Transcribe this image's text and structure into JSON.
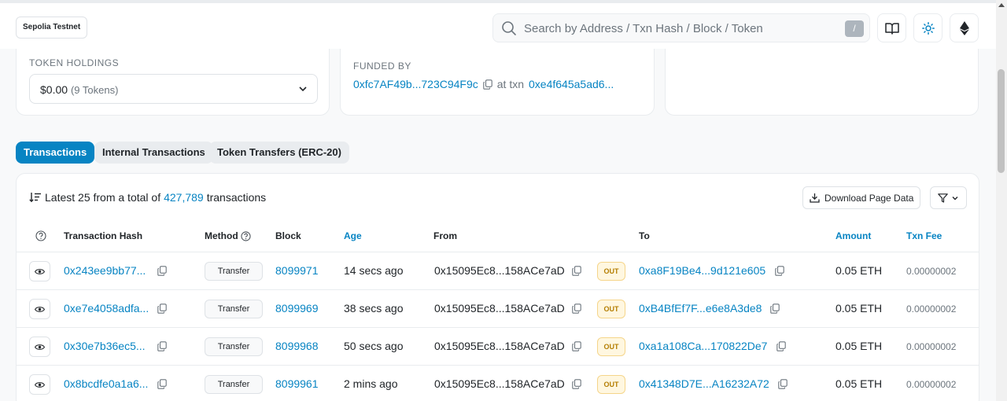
{
  "header": {
    "network_badge": "Sepolia Testnet",
    "search_placeholder": "Search by Address / Txn Hash / Block / Token",
    "search_shortcut": "/"
  },
  "overview": {
    "token_holdings_label": "TOKEN HOLDINGS",
    "token_holdings_value": "$0.00",
    "token_holdings_count": "(9 Tokens)",
    "funded_by_label": "FUNDED BY",
    "funded_by_address": "0xfc7AF49b...723C94F9c",
    "at_txn_text": "at txn",
    "funded_by_txn": "0xe4f645a5ad6..."
  },
  "tabs": [
    {
      "label": "Transactions",
      "active": true
    },
    {
      "label": "Internal Transactions",
      "active": false
    },
    {
      "label": "Token Transfers (ERC-20)",
      "active": false
    }
  ],
  "table": {
    "summary_prefix": "Latest 25 from a total of",
    "summary_count": "427,789",
    "summary_suffix": "transactions",
    "download_label": "Download Page Data",
    "columns": {
      "hash": "Transaction Hash",
      "method": "Method",
      "block": "Block",
      "age": "Age",
      "from": "From",
      "to": "To",
      "amount": "Amount",
      "fee": "Txn Fee"
    },
    "rows": [
      {
        "hash": "0x243ee9bb77...",
        "method": "Transfer",
        "block": "8099971",
        "age": "14 secs ago",
        "from": "0x15095Ec8...158ACe7aD",
        "direction": "OUT",
        "to": "0xa8F19Be4...9d121e605",
        "amount": "0.05 ETH",
        "fee": "0.00000002"
      },
      {
        "hash": "0xe7e4058adfa...",
        "method": "Transfer",
        "block": "8099969",
        "age": "38 secs ago",
        "from": "0x15095Ec8...158ACe7aD",
        "direction": "OUT",
        "to": "0xB4BfEf7F...e6e8A3de8",
        "amount": "0.05 ETH",
        "fee": "0.00000002"
      },
      {
        "hash": "0x30e7b36ec5...",
        "method": "Transfer",
        "block": "8099968",
        "age": "50 secs ago",
        "from": "0x15095Ec8...158ACe7aD",
        "direction": "OUT",
        "to": "0xa1a108Ca...170822De7",
        "amount": "0.05 ETH",
        "fee": "0.00000002"
      },
      {
        "hash": "0x8bcdfe0a1a6...",
        "method": "Transfer",
        "block": "8099961",
        "age": "2 mins ago",
        "from": "0x15095Ec8...158ACe7aD",
        "direction": "OUT",
        "to": "0x41348D7E...A16232A72",
        "amount": "0.05 ETH",
        "fee": "0.00000002"
      }
    ]
  },
  "colors": {
    "accent": "#0784c3",
    "out_badge": "#b47d00"
  }
}
